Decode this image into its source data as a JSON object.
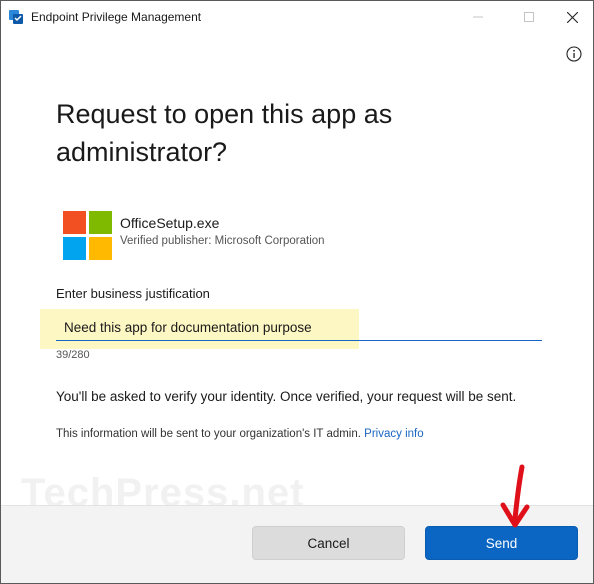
{
  "window": {
    "title": "Endpoint Privilege Management",
    "buttons": [
      "minimize-icon",
      "maximize-icon",
      "close-icon"
    ]
  },
  "dialog": {
    "heading": "Request to open this app as administrator?",
    "app": {
      "name": "OfficeSetup.exe",
      "publisher": "Verified publisher: Microsoft Corporation",
      "icon": "microsoft-logo-icon"
    },
    "justification": {
      "label": "Enter business justification",
      "value": "Need this app for documentation purpose",
      "counter": "39/280"
    },
    "verify_text": "You'll be asked to verify your identity. Once verified, your request will be sent.",
    "info_text": "This information will be sent to your organization's IT admin.",
    "privacy_link": "Privacy info"
  },
  "watermark": "TechPress.net",
  "footer": {
    "cancel_label": "Cancel",
    "send_label": "Send"
  },
  "colors": {
    "accent": "#0a66c2",
    "highlight": "#fdf7c3",
    "arrow": "#e0101a"
  }
}
